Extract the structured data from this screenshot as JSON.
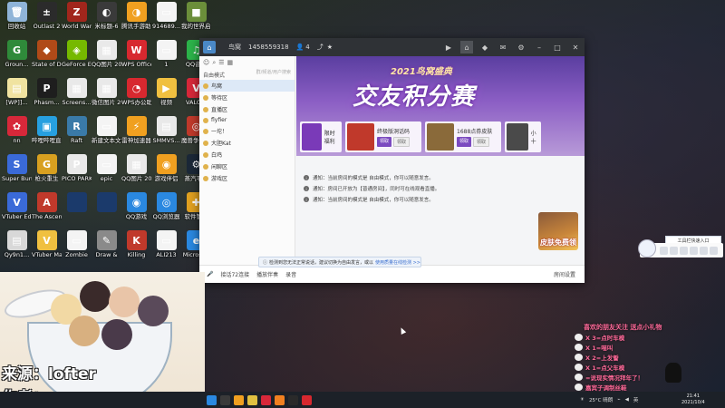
{
  "desktop": {
    "icons": [
      {
        "label": "回收站",
        "color": "#8fb4d8",
        "glyph": "🗑"
      },
      {
        "label": "Outlast 2",
        "color": "#2b2b2b",
        "glyph": "±"
      },
      {
        "label": "World War Z",
        "color": "#a1261c",
        "glyph": "Z"
      },
      {
        "label": "米标题-6",
        "color": "#3a3a3a",
        "glyph": "◐"
      },
      {
        "label": "腾讯手游助手",
        "color": "#f0a020",
        "glyph": "◑"
      },
      {
        "label": "914689...",
        "color": "#f4f4f4",
        "glyph": "▭"
      },
      {
        "label": "我的世界启动器",
        "color": "#6b8e3a",
        "glyph": "■"
      },
      {
        "label": "Groun...",
        "color": "#2f8a3a",
        "glyph": "G"
      },
      {
        "label": "State of Decay 2",
        "color": "#b04a18",
        "glyph": "◆"
      },
      {
        "label": "GeForce Experie...",
        "color": "#76b900",
        "glyph": "◈"
      },
      {
        "label": "QQ图片 202106...",
        "color": "#e9e9e9",
        "glyph": "▦"
      },
      {
        "label": "WPS Office",
        "color": "#d7282f",
        "glyph": "W"
      },
      {
        "label": "1",
        "color": "#f4f4f4",
        "glyph": "▭"
      },
      {
        "label": "QQ音乐",
        "color": "#2cb34a",
        "glyph": "♫"
      },
      {
        "label": "[WP]]...",
        "color": "#f0e3a0",
        "glyph": "▤"
      },
      {
        "label": "Phasm...",
        "color": "#1e1e1e",
        "glyph": "P"
      },
      {
        "label": "Screens...",
        "color": "#e9e9e9",
        "glyph": "▦"
      },
      {
        "label": "微信图片 202109...",
        "color": "#e9e9e9",
        "glyph": "▦"
      },
      {
        "label": "WPS办公助手",
        "color": "#d7282f",
        "glyph": "◔"
      },
      {
        "label": "视频",
        "color": "#f0c040",
        "glyph": "▶"
      },
      {
        "label": "VALO...",
        "color": "#d7283a",
        "glyph": "V"
      },
      {
        "label": "nn",
        "color": "#d7283a",
        "glyph": "✿"
      },
      {
        "label": "哔哩哔哩直播姬",
        "color": "#27a0e0",
        "glyph": "▣"
      },
      {
        "label": "Raft",
        "color": "#3a7aa8",
        "glyph": "R"
      },
      {
        "label": "新建文本文档",
        "color": "#f4f4f4",
        "glyph": "▭"
      },
      {
        "label": "雷神加速器",
        "color": "#f0a020",
        "glyph": "⚡"
      },
      {
        "label": "SMMVS...",
        "color": "#e9e9e9",
        "glyph": "▤"
      },
      {
        "label": "魔兽争霸平台",
        "color": "#c0392b",
        "glyph": "◎"
      },
      {
        "label": "Super Bun...",
        "color": "#3a6ad8",
        "glyph": "S"
      },
      {
        "label": "枪火重生",
        "color": "#d8a020",
        "glyph": "G"
      },
      {
        "label": "PICO PARK",
        "color": "#e9e9e9",
        "glyph": "P"
      },
      {
        "label": "epic",
        "color": "#f4f4f4",
        "glyph": "▭"
      },
      {
        "label": "QQ图片 202002...",
        "color": "#e9e9e9",
        "glyph": "▦"
      },
      {
        "label": "游戏伴侣",
        "color": "#f0a020",
        "glyph": "◉"
      },
      {
        "label": "蒸汽平台",
        "color": "#1b2838",
        "glyph": "⚙"
      },
      {
        "label": "VTuber Editor",
        "color": "#3a6ad8",
        "glyph": "V"
      },
      {
        "label": "The Ascent",
        "color": "#c0392b",
        "glyph": "A"
      },
      {
        "label": "",
        "color": "#1b3a6b",
        "glyph": ""
      },
      {
        "label": "",
        "color": "#1b3a6b",
        "glyph": ""
      },
      {
        "label": "QQ游戏",
        "color": "#2a88e0",
        "glyph": "◉"
      },
      {
        "label": "QQ浏览器",
        "color": "#2a88e0",
        "glyph": "◎"
      },
      {
        "label": "软件管理",
        "color": "#e0a020",
        "glyph": "✚"
      },
      {
        "label": "Qy9n1...",
        "color": "#d8d8d8",
        "glyph": "▤"
      },
      {
        "label": "VTuber Maker",
        "color": "#f0c040",
        "glyph": "V"
      },
      {
        "label": "Zombie",
        "color": "#f4f4f4",
        "glyph": "▭"
      },
      {
        "label": "Draw &",
        "color": "#8a8a8a",
        "glyph": "✎"
      },
      {
        "label": "Killing",
        "color": "#c0392b",
        "glyph": "K"
      },
      {
        "label": "ALI213",
        "color": "#f4f4f4",
        "glyph": "▭"
      },
      {
        "label": "Microsoft",
        "color": "#2a88e0",
        "glyph": "e"
      },
      {
        "label": "5E对战平",
        "color": "#2a2a2a",
        "glyph": "5"
      }
    ]
  },
  "qq_window": {
    "title_name": "鸟窝",
    "title_id": "1458559318",
    "title_members": "4",
    "left": {
      "mode": "自由模式",
      "search_hint": "群/频道/用户搜索",
      "rows": [
        {
          "label": "鸟窝",
          "selected": true
        },
        {
          "label": "等待区",
          "selected": false
        },
        {
          "label": "直播区",
          "selected": false
        },
        {
          "label": "flyfier",
          "selected": false
        },
        {
          "label": "一坨！",
          "selected": false
        },
        {
          "label": "大胆Kat",
          "selected": false
        },
        {
          "label": "白鸡",
          "selected": false
        },
        {
          "label": "闲聊区",
          "selected": false
        },
        {
          "label": "游戏区",
          "selected": false
        }
      ]
    },
    "banner": {
      "subtitle": "2021鸟窝盛典",
      "headline": "交友积分赛"
    },
    "cards": [
      {
        "name": "限时福利",
        "btn1": "",
        "btn2": "",
        "color": "#7a3ab8"
      },
      {
        "name": "终极版洞话码",
        "btn1": "领取",
        "btn2": "领取",
        "color": "#c0392b"
      },
      {
        "name": "1688点券皮肤",
        "btn1": "领取",
        "btn2": "领取",
        "color": "#8a6a3a"
      },
      {
        "name": "小十",
        "btn1": "",
        "btn2": "",
        "color": "#4a4a4a"
      }
    ],
    "notices": [
      "通知：当前房间的模式是 自由模式，你可以随意发言。",
      "通知：房间已开放为【普通房间】，同时可在线观看直播。",
      "通知：当前房间的模式是 自由模式，你可以随意发言。"
    ],
    "chat_tip": "检测到您无法正常说话，建议切换为自由发言，或以",
    "chat_tip_link": "使用质量在线检测 >>",
    "footer": {
      "mic": "接话72连接",
      "sub": "播放伴奏",
      "record": "录音",
      "right": "房间设置"
    },
    "promo_text": "皮肤免费领"
  },
  "widget": {
    "text": "工具栏快速入口"
  },
  "overlay": {
    "title": "喜欢的朋友关注 送点小礼物",
    "lines": [
      "X 3=点时车模",
      "X 1=喵叫",
      "X 2=上发誓",
      "X 1=点父车模",
      "=说现实情况拜年了！",
      "嘉宾子调制丝鞋"
    ]
  },
  "art": {
    "source": "来源：lofter",
    "author": "作者：oran"
  },
  "taskbar": {
    "weather": "25°C 晴朗",
    "lang": "英",
    "time": "21:41",
    "date": "2021/10/4"
  }
}
